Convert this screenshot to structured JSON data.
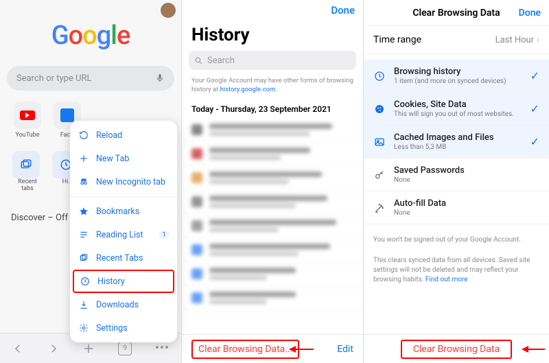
{
  "panel1": {
    "logo_letters": [
      "G",
      "o",
      "o",
      "g",
      "l",
      "e"
    ],
    "search_placeholder": "Search or type URL",
    "shortcuts": [
      {
        "label": "YouTube"
      },
      {
        "label": "Fac…"
      }
    ],
    "recent_tiles": [
      {
        "label": "Recent tabs"
      },
      {
        "label": "Hi…"
      }
    ],
    "discover": "Discover – Off",
    "tab_count": "9",
    "menu": {
      "reload": "Reload",
      "new_tab": "New Tab",
      "new_incognito": "New Incognito tab",
      "bookmarks": "Bookmarks",
      "reading_list": "Reading List",
      "reading_badge": "1",
      "recent_tabs": "Recent Tabs",
      "history": "History",
      "downloads": "Downloads",
      "settings": "Settings"
    }
  },
  "panel2": {
    "done": "Done",
    "title": "History",
    "search_placeholder": "Search",
    "info_text": "Your Google Account may have other forms of browsing history at ",
    "info_link": "history.google.com",
    "date_header": "Today - Thursday, 23 September 2021",
    "clear": "Clear Browsing Data...",
    "edit": "Edit"
  },
  "panel3": {
    "title": "Clear Browsing Data",
    "done": "Done",
    "time_range_label": "Time range",
    "time_range_value": "Last Hour",
    "options": [
      {
        "title": "Browsing history",
        "sub": "1 item (and more on synced devices)",
        "selected": true,
        "icon": "history"
      },
      {
        "title": "Cookies, Site Data",
        "sub": "This will sign you out of most websites.",
        "selected": true,
        "icon": "cookie"
      },
      {
        "title": "Cached Images and Files",
        "sub": "Less than 5,3 MB",
        "selected": true,
        "icon": "cache"
      },
      {
        "title": "Saved Passwords",
        "sub": "None",
        "selected": false,
        "icon": "key"
      },
      {
        "title": "Auto-fill Data",
        "sub": "None",
        "selected": false,
        "icon": "autofill"
      }
    ],
    "note1": "You won't be signed out of your Google Account.",
    "note2_a": "This clears synced data from all devices. Saved site settings will not be deleted and may reflect your browsing habits. ",
    "note2_link": "Find out more",
    "clear": "Clear Browsing Data"
  }
}
